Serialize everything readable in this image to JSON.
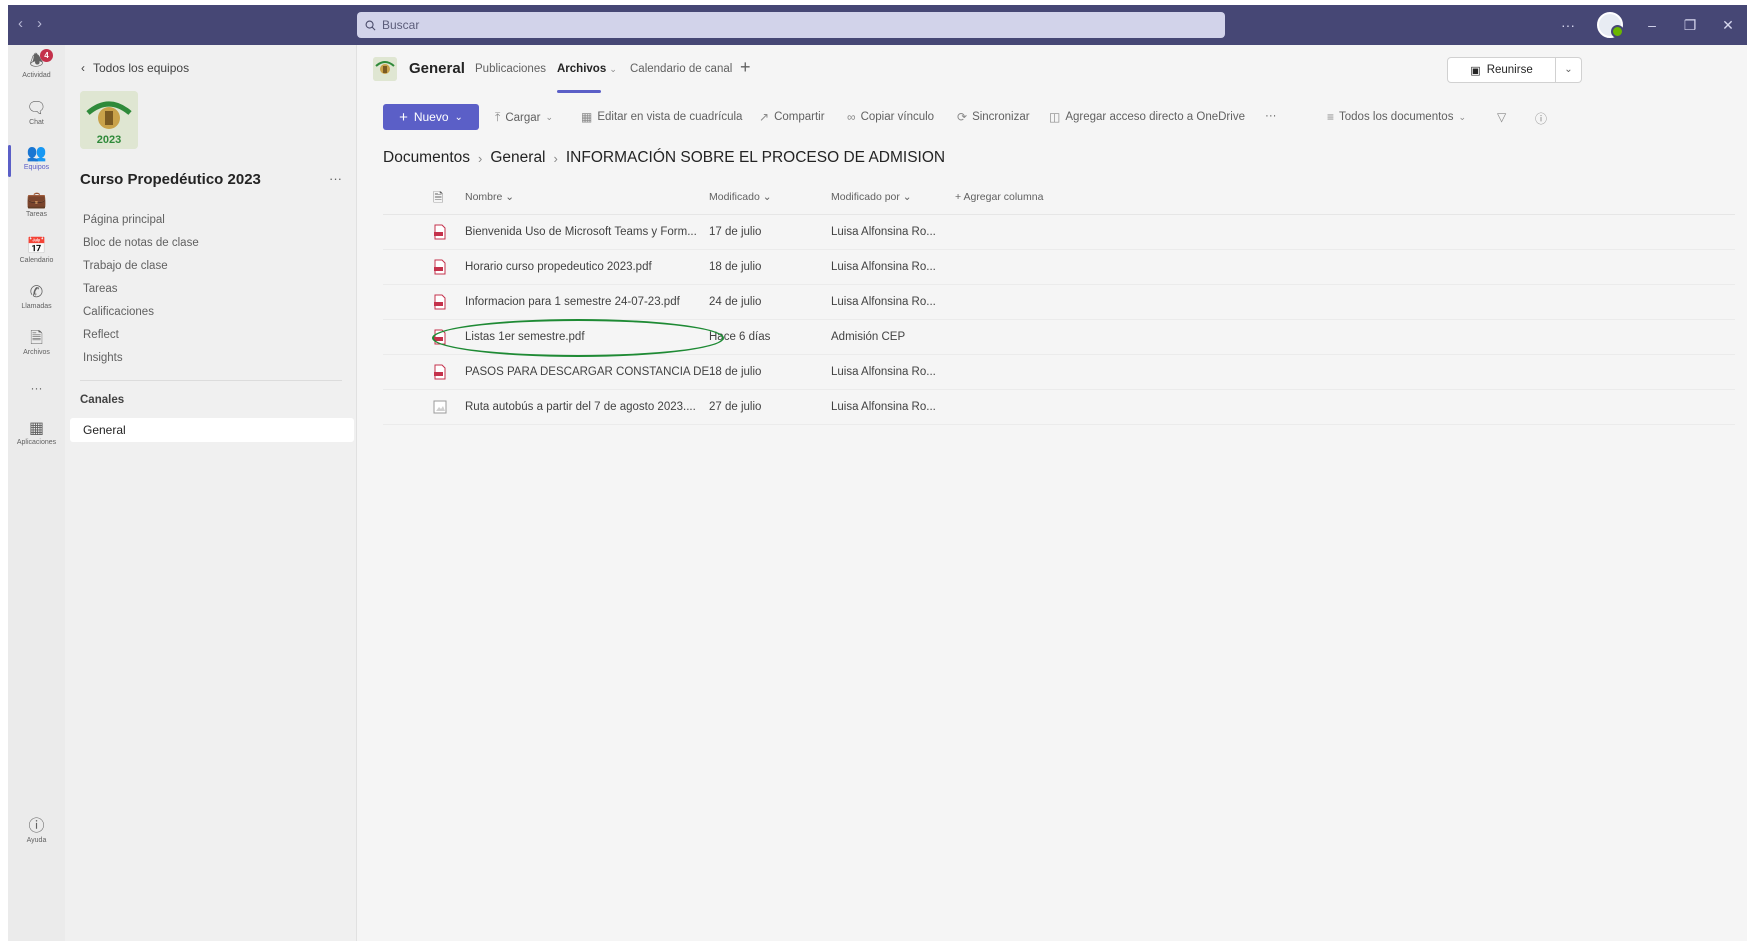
{
  "titlebar": {
    "search_placeholder": "Buscar",
    "more_label": "···",
    "minimize_label": "–",
    "restore_label": "❐",
    "close_label": "✕"
  },
  "rail": {
    "items": [
      {
        "label": "Actividad",
        "icon": "bell-icon",
        "badge": "4"
      },
      {
        "label": "Chat",
        "icon": "chat-icon"
      },
      {
        "label": "Equipos",
        "icon": "teams-icon"
      },
      {
        "label": "Tareas",
        "icon": "tasks-icon"
      },
      {
        "label": "Calendario",
        "icon": "calendar-icon"
      },
      {
        "label": "Llamadas",
        "icon": "phone-icon"
      },
      {
        "label": "Archivos",
        "icon": "file-icon"
      },
      {
        "label": "···",
        "icon": "more-icon"
      },
      {
        "label": "Aplicaciones",
        "icon": "apps-icon"
      },
      {
        "label": "Ayuda",
        "icon": "help-icon"
      }
    ]
  },
  "team": {
    "back_label": "Todos los equipos",
    "name": "Curso Propedéutico 2023",
    "logo_text": "2023",
    "more_label": "···",
    "menu": [
      "Página principal",
      "Bloc de notas de clase",
      "Trabajo de clase",
      "Tareas",
      "Calificaciones",
      "Reflect",
      "Insights"
    ],
    "channels_label": "Canales",
    "channels": [
      "General"
    ]
  },
  "channel": {
    "title": "General",
    "tabs": [
      "Publicaciones",
      "Archivos",
      "Calendario de canal"
    ],
    "add_tab": "+",
    "meet_label": "Reunirse"
  },
  "toolbar": {
    "new_label": "Nuevo",
    "upload_label": "Cargar",
    "grid_edit_label": "Editar en vista de cuadrícula",
    "share_label": "Compartir",
    "copy_link_label": "Copiar vínculo",
    "sync_label": "Sincronizar",
    "shortcut_label": "Agregar acceso directo a OneDrive",
    "more_label": "···",
    "view_label": "Todos los documentos"
  },
  "breadcrumb": [
    "Documentos",
    "General",
    "INFORMACIÓN SOBRE EL PROCESO DE ADMISION"
  ],
  "files": {
    "columns": {
      "name": "Nombre",
      "modified": "Modificado",
      "modified_by": "Modificado por",
      "add_column": "+ Agregar columna"
    },
    "rows": [
      {
        "name": "Bienvenida Uso  de Microsoft Teams y Form...",
        "modified": "17 de julio",
        "modified_by": "Luisa Alfonsina Ro...",
        "type": "pdf"
      },
      {
        "name": "Horario curso propedeutico 2023.pdf",
        "modified": "18 de julio",
        "modified_by": "Luisa Alfonsina Ro...",
        "type": "pdf"
      },
      {
        "name": "Informacion para 1 semestre 24-07-23.pdf",
        "modified": "24 de julio",
        "modified_by": "Luisa Alfonsina Ro...",
        "type": "pdf"
      },
      {
        "name": "Listas 1er semestre.pdf",
        "modified": "Hace 6 días",
        "modified_by": "Admisión CEP",
        "type": "pdf"
      },
      {
        "name": "PASOS PARA DESCARGAR CONSTANCIA DE...",
        "modified": "18 de julio",
        "modified_by": "Luisa Alfonsina Ro...",
        "type": "pdf"
      },
      {
        "name": "Ruta autobús a partir del 7 de agosto 2023....",
        "modified": "27 de julio",
        "modified_by": "Luisa Alfonsina Ro...",
        "type": "image"
      }
    ]
  },
  "colors": {
    "titlebar": "#464775",
    "accent": "#5b5fc7",
    "pdf_red": "#c4314b",
    "highlight": "#1e8a34"
  }
}
